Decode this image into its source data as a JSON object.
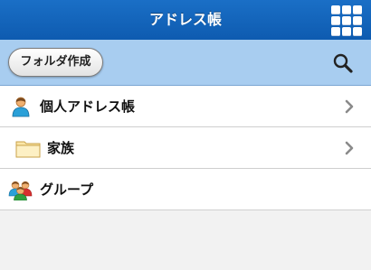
{
  "header": {
    "title": "アドレス帳",
    "menu_icon": "grid-menu-icon"
  },
  "toolbar": {
    "new_folder_label": "フォルダ作成",
    "search_icon": "search-icon"
  },
  "list": {
    "items": [
      {
        "label": "個人アドレス帳",
        "icon": "person-icon"
      },
      {
        "label": "家族",
        "icon": "folder-icon"
      },
      {
        "label": "グループ",
        "icon": "group-icon"
      }
    ]
  },
  "colors": {
    "header_bg": "#1166bf",
    "toolbar_bg": "#a8cdf0",
    "list_bg": "#ffffff",
    "page_bg": "#f2f2f2"
  }
}
